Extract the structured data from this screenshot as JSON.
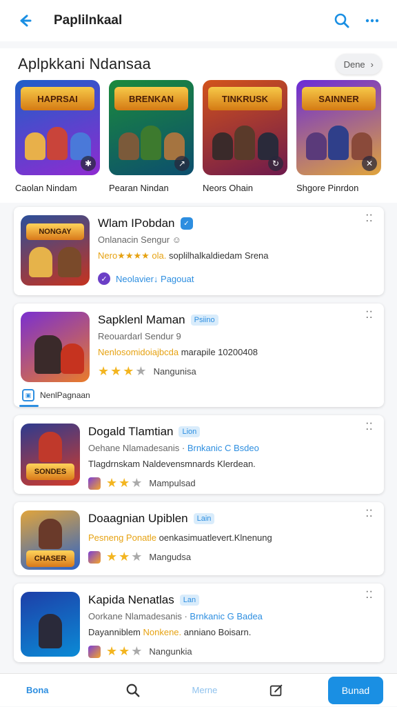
{
  "header": {
    "title": "Paplilnkaal"
  },
  "section": {
    "title": "Aplpkkani  Ndansaa",
    "see_all": "Dene"
  },
  "featured": [
    {
      "label": "Caolan Nindam",
      "logo": "HAPRSAI",
      "colors": [
        "#1f5fc8",
        "#8e2bd1"
      ],
      "badge": "✱"
    },
    {
      "label": "Pearan Nindan",
      "logo": "BRENKAN",
      "colors": [
        "#1b8a3c",
        "#0c4e6e"
      ],
      "badge": "↗"
    },
    {
      "label": "Neors Ohain",
      "logo": "TINKRUSK",
      "colors": [
        "#d2531b",
        "#6e1a4c"
      ],
      "badge": "↻"
    },
    {
      "label": "Shgore Pinrdon",
      "logo": "SAINNER",
      "colors": [
        "#6a2bd8",
        "#e0a43c"
      ],
      "badge": "✕"
    }
  ],
  "apps": [
    {
      "name": "Wlam IPobdan",
      "tag": "",
      "verified": "✓",
      "sub": "Onlanacin Sengur ☺",
      "desc_hl": "Nero★★★★ ola.",
      "desc": " soplilhalkaldiedam Srena",
      "check_label": "Neolavier↓ Pagouat",
      "colors": [
        "#2b4f9a",
        "#c6331f"
      ],
      "logo": "NONGAY"
    },
    {
      "name": "Sapklenl Maman",
      "tag": "Psiino",
      "sub": "Reouardarl Sendur 9",
      "desc_hl": "Nenlosomidoiajbcda",
      "desc": " marapile 10200408",
      "rating": 3,
      "rating_label": "Nangunisa",
      "footer": "NenlPagnaan",
      "colors": [
        "#7a2fd0",
        "#e97c2a"
      ],
      "logo": ""
    },
    {
      "name": "Dogald Tlamtian",
      "tag": "Lion",
      "sub": "Oehane Nlamadesanis · ",
      "sub_blue": "Brnkanic C Bsdeo",
      "desc": "Tlagdrnskam Naldevensmnards Klerdean.",
      "rating": 3,
      "rating_label": "Mampulsad",
      "colors": [
        "#2d3b8f",
        "#d23b2a"
      ],
      "logo": "SONDES"
    },
    {
      "name": "Doaagnian Upiblen",
      "tag": "Lain",
      "sub": "",
      "desc_hl": "Pesneng Ponatle",
      "desc": " oenkasimuatlevert.Klnenung",
      "rating": 3,
      "rating_label": "Mangudsa",
      "colors": [
        "#e0a43c",
        "#2b63c8"
      ],
      "logo": "CHASER"
    },
    {
      "name": "Kapida Nenatlas",
      "tag": "Lan",
      "sub": "Oorkane Nlamadesanis · ",
      "sub_blue": "Brnkanic G Badea",
      "desc": "Dayanniblem ",
      "desc_hl2": "Nonkene.",
      "desc2": " anniano Boisarn.",
      "rating": 3,
      "rating_label": "Nangunkia",
      "colors": [
        "#1d3fa8",
        "#0b8bd6"
      ],
      "logo": ""
    }
  ],
  "bottom_nav": {
    "home": "Bona",
    "menu": "Merne",
    "cta": "Bunad"
  }
}
